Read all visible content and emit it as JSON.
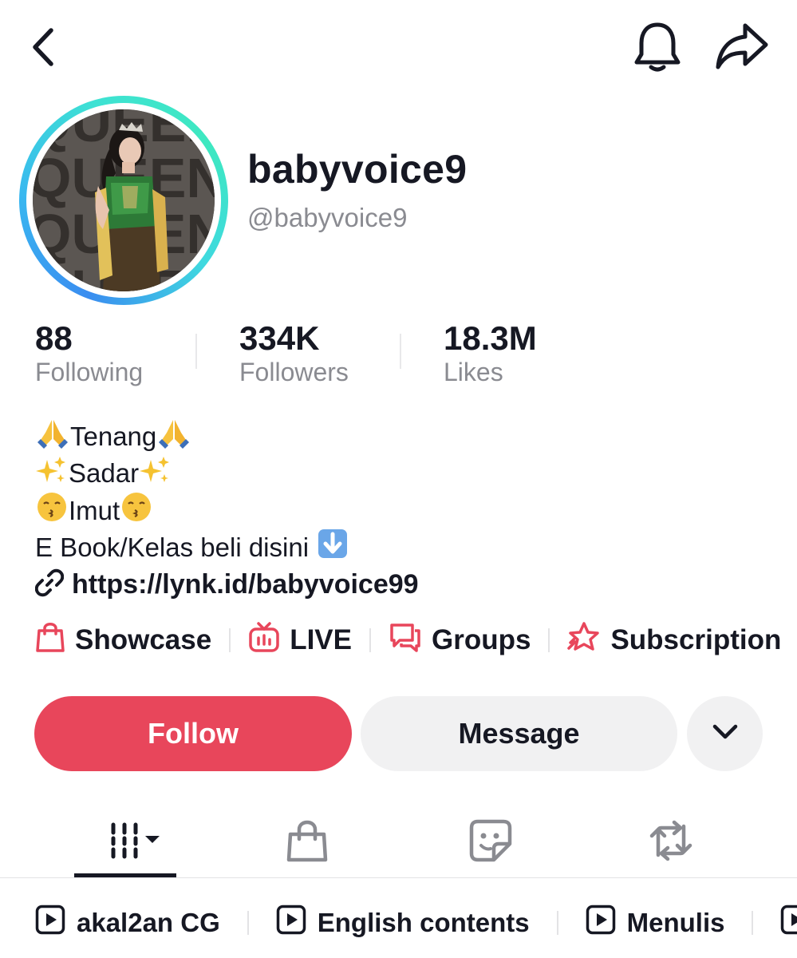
{
  "profile": {
    "display_name": "babyvoice9",
    "handle": "@babyvoice9"
  },
  "stats": {
    "following": {
      "value": "88",
      "label": "Following"
    },
    "followers": {
      "value": "334K",
      "label": "Followers"
    },
    "likes": {
      "value": "18.3M",
      "label": "Likes"
    }
  },
  "bio": {
    "line1": "Tenang",
    "line2": "Sadar",
    "line3": "Imut",
    "line4": "E Book/Kelas beli disini",
    "link": "https://lynk.id/babyvoice99"
  },
  "features": {
    "showcase": "Showcase",
    "live": "LIVE",
    "groups": "Groups",
    "subscription": "Subscription"
  },
  "actions": {
    "follow": "Follow",
    "message": "Message"
  },
  "tabs": [
    "videos-grid",
    "shop",
    "favorites-sticker",
    "reposts"
  ],
  "playlists": [
    "akal2an CG",
    "English contents",
    "Menulis"
  ],
  "colors": {
    "accent": "#e8465b",
    "text_primary": "#161823",
    "text_secondary": "#8a8b91",
    "button_secondary": "#f1f1f2",
    "avatar_ring_start": "#3a8df0",
    "avatar_ring_end": "#3ee8c0"
  },
  "photo_text": "QUEEN"
}
